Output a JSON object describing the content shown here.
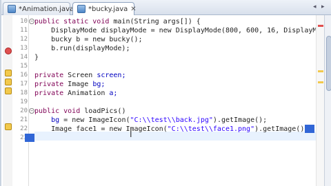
{
  "tabs": [
    {
      "label": "*Animation.java",
      "close": "✕"
    },
    {
      "label": "*bucky.java",
      "close": "✕"
    }
  ],
  "tab_scroll": {
    "left": "◂",
    "right": "▸"
  },
  "line_numbers": [
    "10",
    "11",
    "12",
    "13",
    "14",
    "15",
    "16",
    "17",
    "18",
    "19",
    "20",
    "21",
    "22",
    "23"
  ],
  "code": {
    "l1": {
      "kw": "public static void",
      "rest": " main(String args[]) {"
    },
    "l2": {
      "text": "    DisplayMode displayMode = new DisplayMode(800, 600, 16, DisplayMo"
    },
    "l3": {
      "text": "    bucky b = new bucky();"
    },
    "l4": {
      "text": "    b.run(displayMode);"
    },
    "l5": {
      "text": "}"
    },
    "l6": {
      "text": ""
    },
    "l7": {
      "kw": "private",
      "rest": " Screen ",
      "field": "screen;"
    },
    "l8": {
      "kw": "private",
      "rest": " Image ",
      "field": "bg;"
    },
    "l9": {
      "kw": "private",
      "rest": " Animation ",
      "field": "a;"
    },
    "l10": {
      "text": ""
    },
    "l11": {
      "kw": "public void",
      "rest": " loadPics()"
    },
    "l12": {
      "pre": "    ",
      "field": "bg",
      "mid": " = new ImageIcon(",
      "str": "\"C:\\\\test\\\\back.jpg\"",
      "post": ").getImage();"
    },
    "l13": {
      "pre": "    Image face1 = new ImageIcon(",
      "str": "\"C:\\\\test\\\\face1.png\"",
      "post": ").getImage();"
    },
    "l14": {
      "text": ""
    }
  },
  "colors": {
    "keyword": "#7f0055",
    "field": "#0000c0",
    "string": "#2a00ff",
    "selection": "#3166d6"
  },
  "cursor_icon": "I-beam-cursor-icon"
}
